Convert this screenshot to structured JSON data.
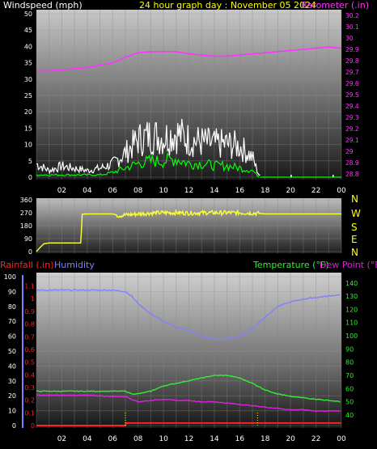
{
  "colors": {
    "background": "#000000",
    "axis_text": "#ffffff",
    "title": "#ffff00",
    "barometer": "#ff33ff",
    "wind_speed": "#ffffff",
    "wind_avg": "#00ff00",
    "wind_dir": "#ffff33",
    "rainfall": "#ff2222",
    "humidity": "#8080ff",
    "temperature": "#33ee33",
    "dewpoint": "#dd22dd",
    "dawn_dusk": "#ffff00"
  },
  "header": {
    "windspeed_label": "Windspeed (mph)",
    "title": "24 hour graph day : November 05 2024",
    "barometer_label": "Barometer (.in)"
  },
  "compass": [
    "N",
    "W",
    "S",
    "E",
    "N"
  ],
  "legend": {
    "rainfall": "Rainfall (.in)",
    "humidity": "Humidity",
    "temperature": "Temperature (°F)",
    "dewpoint": "Dew Point (°F)"
  },
  "chart_data": [
    {
      "type": "line",
      "panel": "wind-barometer",
      "x_tick_labels": [
        "02",
        "04",
        "06",
        "08",
        "10",
        "12",
        "14",
        "16",
        "18",
        "20",
        "22",
        "00"
      ],
      "y_left_ticks": [
        0,
        5,
        10,
        15,
        20,
        25,
        30,
        35,
        40,
        45,
        50
      ],
      "y_left_range": [
        0,
        50
      ],
      "y_right_ticks": [
        28.8,
        28.9,
        29.0,
        29.1,
        29.2,
        29.3,
        29.4,
        29.5,
        29.6,
        29.7,
        29.8,
        29.9,
        30.0,
        30.1,
        30.2
      ],
      "y_right_labels": [
        "28.8",
        "28.9",
        "29",
        "29.1",
        "29.2",
        "29.3",
        "29.4",
        "29.5",
        "29.6",
        "29.7",
        "29.8",
        "29.9",
        "30",
        "30.1",
        "30.2"
      ],
      "y_right_range": [
        28.75,
        30.25
      ],
      "series": [
        {
          "name": "Barometer",
          "axis": "right",
          "x": [
            0,
            1,
            2,
            3,
            4,
            5,
            6,
            7,
            8,
            9,
            10,
            11,
            12,
            13,
            14,
            15,
            16,
            17,
            18,
            19,
            20,
            21,
            22,
            23,
            24
          ],
          "y": [
            29.71,
            29.71,
            29.72,
            29.73,
            29.74,
            29.76,
            29.78,
            29.83,
            29.87,
            29.88,
            29.88,
            29.88,
            29.86,
            29.85,
            29.84,
            29.84,
            29.85,
            29.86,
            29.87,
            29.88,
            29.89,
            29.9,
            29.91,
            29.92,
            29.91
          ]
        },
        {
          "name": "Windspeed gust",
          "axis": "left",
          "x": [
            0,
            1,
            2,
            3,
            4,
            5,
            6,
            7,
            8,
            9,
            10,
            11,
            12,
            13,
            14,
            15,
            16,
            17,
            17.5,
            18,
            24
          ],
          "y": [
            6,
            3,
            5,
            4,
            3,
            4,
            6,
            11,
            17,
            19,
            18,
            20,
            17,
            16,
            15,
            15,
            14,
            9,
            1,
            0,
            0
          ]
        },
        {
          "name": "Windspeed avg",
          "axis": "left",
          "x": [
            0,
            1,
            2,
            3,
            4,
            5,
            6,
            7,
            8,
            9,
            10,
            11,
            12,
            13,
            14,
            15,
            16,
            17,
            17.5,
            18,
            24
          ],
          "y": [
            1,
            1,
            1,
            1,
            1,
            1,
            2,
            4,
            6,
            7,
            7,
            8,
            6,
            6,
            5,
            5,
            4,
            3,
            0,
            0,
            0
          ]
        }
      ]
    },
    {
      "type": "line",
      "panel": "wind-direction",
      "x_tick_labels": [
        "02",
        "04",
        "06",
        "08",
        "10",
        "12",
        "14",
        "16",
        "18",
        "20",
        "22",
        "00"
      ],
      "y_left_ticks": [
        0,
        90,
        180,
        270,
        360
      ],
      "y_range": [
        0,
        360
      ],
      "series": [
        {
          "name": "Wind direction",
          "x": [
            0,
            0.3,
            0.6,
            1,
            2,
            3,
            3.5,
            3.6,
            4,
            5,
            6,
            6.5,
            7,
            8,
            9,
            10,
            11,
            12,
            13,
            14,
            15,
            16,
            17,
            18,
            24
          ],
          "y": [
            0,
            30,
            55,
            60,
            60,
            60,
            60,
            260,
            262,
            262,
            262,
            250,
            255,
            262,
            268,
            270,
            270,
            268,
            270,
            270,
            270,
            270,
            268,
            262,
            262
          ]
        }
      ]
    },
    {
      "type": "line",
      "panel": "temp-humidity-rain",
      "x_tick_labels": [
        "02",
        "04",
        "06",
        "08",
        "10",
        "12",
        "14",
        "16",
        "18",
        "20",
        "22",
        "00"
      ],
      "humidity_ticks": [
        0,
        10,
        20,
        30,
        40,
        50,
        60,
        70,
        80,
        90,
        100
      ],
      "humidity_range": [
        0,
        100
      ],
      "rain_ticks": [
        0,
        0.1,
        0.2,
        0.3,
        0.4,
        0.5,
        0.6,
        0.7,
        0.8,
        0.9,
        1.0,
        1.1
      ],
      "rain_labels": [
        "0",
        "0.1",
        "0.2",
        "0.3",
        "0.4",
        "0.5",
        "0.6",
        "0.7",
        "0.8",
        "0.9",
        "1",
        "1.1"
      ],
      "rain_range": [
        0,
        1.18
      ],
      "temp_ticks": [
        40,
        50,
        60,
        70,
        80,
        90,
        100,
        110,
        120,
        130,
        140
      ],
      "temp_range": [
        32,
        146
      ],
      "series": [
        {
          "name": "Humidity",
          "axis": "humidity",
          "x": [
            0,
            2,
            4,
            6,
            7,
            7.5,
            8,
            9,
            10,
            11,
            12,
            13,
            14,
            15,
            16,
            17,
            18,
            19,
            20,
            21,
            22,
            23,
            24
          ],
          "y": [
            91,
            91,
            91,
            91,
            90,
            87,
            82,
            75,
            70,
            66,
            64,
            60,
            58,
            58,
            60,
            65,
            73,
            80,
            83,
            85,
            86,
            87,
            88
          ]
        },
        {
          "name": "Temperature",
          "axis": "temp",
          "x": [
            0,
            2,
            4,
            6,
            7,
            7.5,
            8,
            9,
            10,
            11,
            12,
            13,
            14,
            15,
            16,
            17,
            18,
            19,
            20,
            21,
            22,
            23,
            24
          ],
          "y": [
            58,
            58,
            58,
            58,
            58,
            56,
            56,
            58,
            62,
            64,
            66,
            68,
            70,
            70,
            68,
            64,
            59,
            56,
            54,
            53,
            52,
            51,
            50
          ]
        },
        {
          "name": "Dew Point",
          "axis": "temp",
          "x": [
            0,
            2,
            4,
            6,
            7,
            7.5,
            8,
            9,
            10,
            11,
            12,
            13,
            14,
            15,
            16,
            17,
            18,
            19,
            20,
            21,
            22,
            23,
            24
          ],
          "y": [
            55,
            55,
            55,
            54,
            54,
            52,
            50,
            51,
            52,
            51,
            51,
            50,
            50,
            49,
            48,
            47,
            46,
            45,
            44,
            44,
            43,
            43,
            43
          ]
        },
        {
          "name": "Rainfall",
          "axis": "rain",
          "x": [
            0,
            7,
            7.05,
            17.5,
            17.55,
            24
          ],
          "y": [
            0,
            0,
            0.02,
            0.02,
            0.02,
            0.02
          ]
        }
      ],
      "markers_hours": [
        7.0,
        17.4
      ]
    }
  ]
}
